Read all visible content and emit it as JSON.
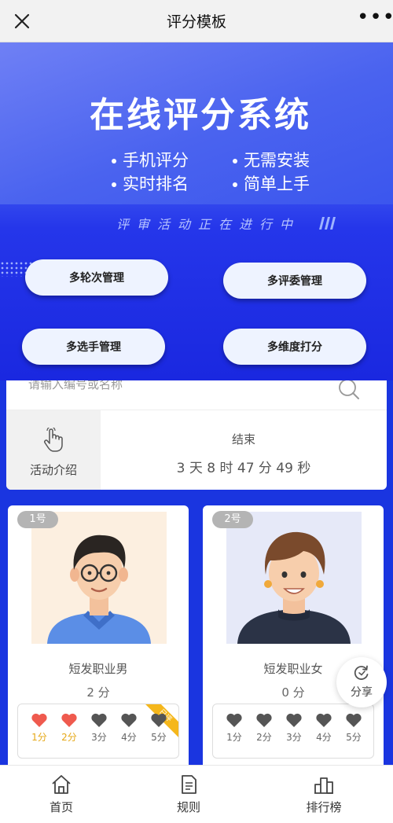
{
  "nav": {
    "title": "评分模板",
    "more": "•••"
  },
  "banner": {
    "headline": "在线评分系统",
    "features": [
      "手机评分",
      "无需安装",
      "实时排名",
      "简单上手"
    ],
    "status": "评审活动正在进行中",
    "buttons": [
      "多轮次管理",
      "多评委管理",
      "多选手管理",
      "多维度打分"
    ]
  },
  "search": {
    "placeholder": "请输入编号或名称"
  },
  "info": {
    "intro_label": "活动介绍",
    "end_label": "结束",
    "countdown": "3 天 8 时 47 分 49 秒"
  },
  "contestants": [
    {
      "number": "1号",
      "name": "短发职业男",
      "score": "2 分",
      "ribbon": "已评",
      "options": [
        {
          "label": "1分",
          "selected": true
        },
        {
          "label": "2分",
          "selected": true
        },
        {
          "label": "3分",
          "selected": false
        },
        {
          "label": "4分",
          "selected": false
        },
        {
          "label": "5分",
          "selected": false
        }
      ]
    },
    {
      "number": "2号",
      "name": "短发职业女",
      "score": "0 分",
      "options": [
        {
          "label": "1分",
          "selected": false
        },
        {
          "label": "2分",
          "selected": false
        },
        {
          "label": "3分",
          "selected": false
        },
        {
          "label": "4分",
          "selected": false
        },
        {
          "label": "5分",
          "selected": false
        }
      ]
    }
  ],
  "share": {
    "label": "分享"
  },
  "tabs": [
    {
      "label": "首页",
      "icon": "home-icon"
    },
    {
      "label": "规则",
      "icon": "document-icon"
    },
    {
      "label": "排行榜",
      "icon": "ranking-icon"
    }
  ],
  "colors": {
    "background": "#1a35e0",
    "heart_on": "#ef5a4e",
    "heart_off": "#555555",
    "selected_text": "#e6a817",
    "ribbon": "#f5b71c"
  }
}
